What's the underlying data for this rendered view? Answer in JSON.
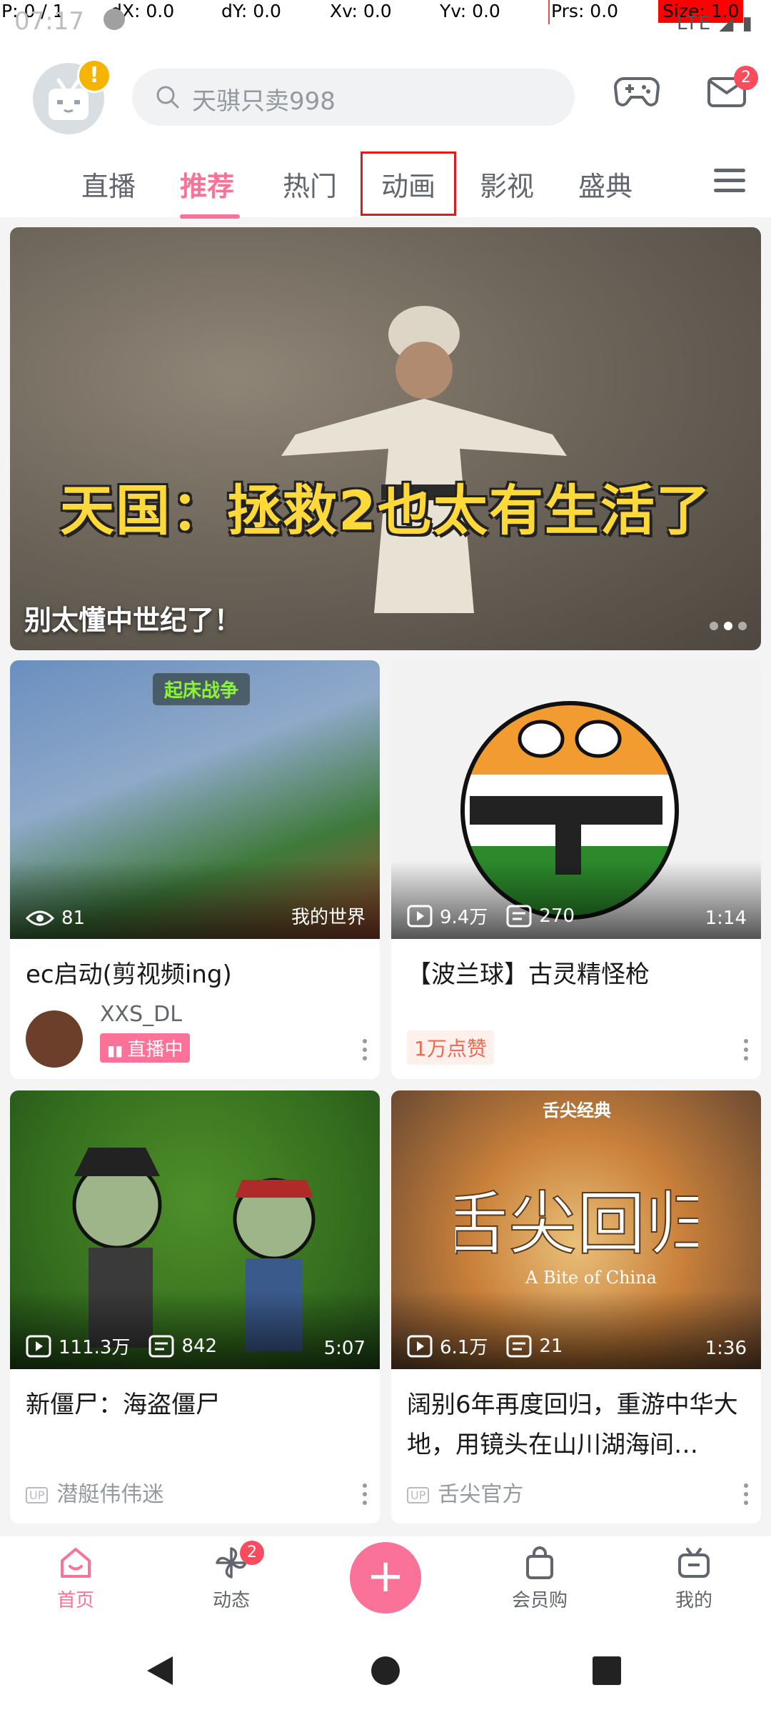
{
  "debug": {
    "p": "P: 0 / 1",
    "dx": "dX: 0.0",
    "dy": "dY: 0.0",
    "xv": "Xv: 0.0",
    "yv": "Yv: 0.0",
    "prs": "Prs: 0.0",
    "size": "Size: 1.0"
  },
  "status": {
    "time": "07:17",
    "network": "LTE"
  },
  "header": {
    "avatar_badge": "!",
    "search_placeholder": "天骐只卖998",
    "mail_badge": "2"
  },
  "tabs": [
    "直播",
    "推荐",
    "热门",
    "动画",
    "影视",
    "盛典"
  ],
  "banner": {
    "headline": "天国：拯救2也太有生活了",
    "caption": "别太懂中世纪了！"
  },
  "cards": [
    {
      "badge": "起床战争",
      "views": "81",
      "tag": "我的世界",
      "title": "ec启动(剪视频ing)",
      "author": "XXS_DL",
      "live": "直播中"
    },
    {
      "views": "9.4万",
      "danmaku": "270",
      "duration": "1:14",
      "title": "【波兰球】古灵精怪枪",
      "likes": "1万点赞"
    },
    {
      "views": "111.3万",
      "danmaku": "842",
      "duration": "5:07",
      "title": "新僵尸：海盗僵尸",
      "author": "潜艇伟伟迷"
    },
    {
      "badge": "舌尖经典",
      "views": "6.1万",
      "danmaku": "21",
      "duration": "1:36",
      "title": "阔别6年再度回归，重游中华大地，用镜头在山川湖海间…",
      "author": "舌尖官方"
    }
  ],
  "bottom_nav": {
    "home": "首页",
    "dynamic": "动态",
    "dynamic_badge": "2",
    "shop": "会员购",
    "mine": "我的",
    "up_tag": "UP"
  },
  "colors": {
    "accent": "#fb7299",
    "badge": "#fb4b5c"
  }
}
